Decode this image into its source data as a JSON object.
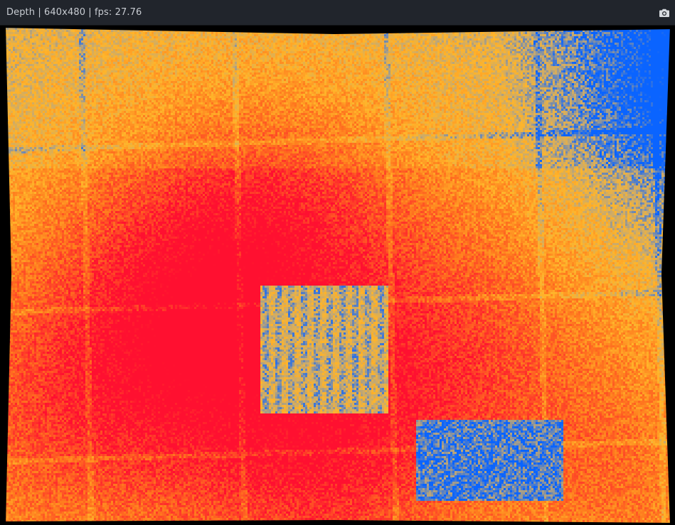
{
  "window": {
    "title": "Depth | 640x480 | fps: 27.76"
  },
  "toolbar": {
    "snapshot_icon": "camera-icon"
  },
  "colormap": {
    "near": "#ff1030",
    "mid_near": "#ff7a1e",
    "mid": "#ffb52a",
    "far": "#0a64ff"
  }
}
